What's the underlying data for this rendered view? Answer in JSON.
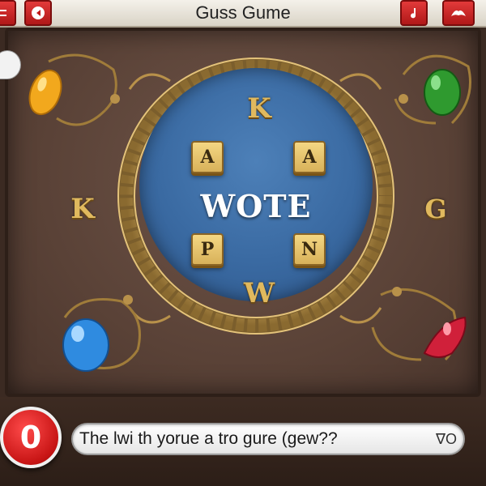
{
  "header": {
    "title": "Guss Gume",
    "left_buttons": [
      {
        "icon": "menu-icon"
      },
      {
        "icon": "back-arrow-icon"
      }
    ],
    "right_buttons": [
      {
        "icon": "sound-icon"
      },
      {
        "icon": "settings-icon"
      }
    ]
  },
  "board": {
    "center_word": "WOTE",
    "tiles": {
      "top_left": "A",
      "top_right": "A",
      "bottom_left": "P",
      "bottom_right": "N"
    },
    "ring_letters": {
      "top": "K",
      "bottom": "W",
      "left": "K",
      "right": "G"
    },
    "gems": [
      {
        "name": "yellow-gem",
        "color": "#f2a81d"
      },
      {
        "name": "green-gem",
        "color": "#2f9a2f"
      },
      {
        "name": "blue-gem",
        "color": "#2f8be0"
      },
      {
        "name": "red-gem",
        "color": "#d0203a"
      }
    ]
  },
  "footer": {
    "score": "0",
    "guess_text": "The lwi th yorue a tro gure (gew??",
    "guess_suffix": "∇O"
  },
  "colors": {
    "accent_red": "#d81e1e",
    "board_brown": "#5a4237",
    "disc_blue": "#3a6aa2",
    "tile_gold": "#e8c46e"
  }
}
